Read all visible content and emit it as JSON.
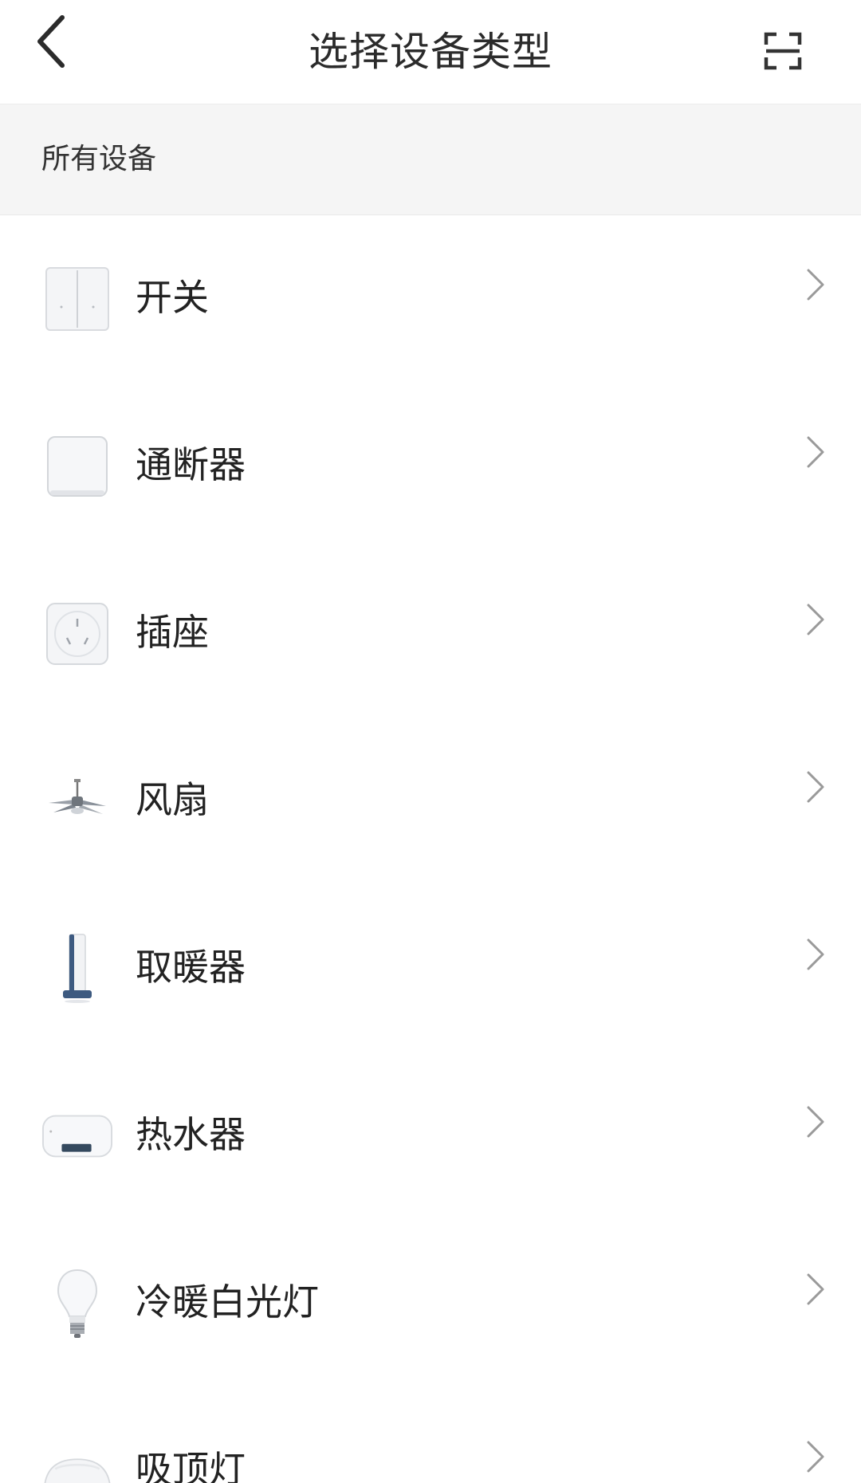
{
  "header": {
    "back_icon": "chevron-left-icon",
    "title": "选择设备类型",
    "scan_icon": "scan-icon"
  },
  "section": {
    "title": "所有设备"
  },
  "devices": [
    {
      "label": "开关",
      "icon": "wall-switch-icon"
    },
    {
      "label": "通断器",
      "icon": "relay-icon"
    },
    {
      "label": "插座",
      "icon": "socket-icon"
    },
    {
      "label": "风扇",
      "icon": "ceiling-fan-icon"
    },
    {
      "label": "取暖器",
      "icon": "heater-icon"
    },
    {
      "label": "热水器",
      "icon": "water-heater-icon"
    },
    {
      "label": "冷暖白光灯",
      "icon": "bulb-icon"
    },
    {
      "label": "吸顶灯",
      "icon": "ceiling-light-icon"
    }
  ],
  "colors": {
    "text_primary": "#222222",
    "section_bg": "#f5f5f5",
    "chevron": "#9a9a9a",
    "divider": "#ececec"
  }
}
